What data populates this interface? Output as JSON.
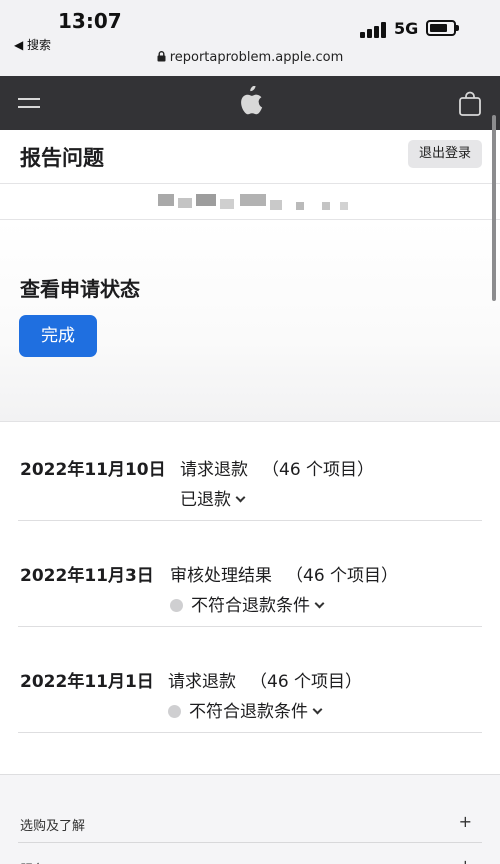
{
  "status_bar": {
    "time": "13:07",
    "back_label": "◀ 搜索",
    "network": "5G",
    "url": "reportaproblem.apple.com"
  },
  "nav": {
    "menu_icon": "menu-icon",
    "logo_icon": "apple-logo-icon",
    "bag_icon": "shopping-bag-icon"
  },
  "header": {
    "title": "报告问题",
    "signout_label": "退出登录"
  },
  "status_section": {
    "heading": "查看申请状态",
    "done_label": "完成"
  },
  "requests": [
    {
      "date": "2022年11月10日",
      "kind": "请求退款",
      "count": "（46 个项目）",
      "state": "已退款",
      "has_dot": false
    },
    {
      "date": "2022年11月3日",
      "kind": "审核处理结果",
      "count": "（46 个项目）",
      "state": "不符合退款条件",
      "has_dot": true
    },
    {
      "date": "2022年11月1日",
      "kind": "请求退款",
      "count": "（46 个项目）",
      "state": "不符合退款条件",
      "has_dot": true
    }
  ],
  "footer": {
    "items": [
      {
        "label": "选购及了解",
        "icon": "+"
      },
      {
        "label": "服务",
        "icon": "+"
      }
    ]
  },
  "colors": {
    "nav_bg": "#333336",
    "primary_button": "#1f6fe0",
    "status_dot": "#cfcfd1"
  }
}
